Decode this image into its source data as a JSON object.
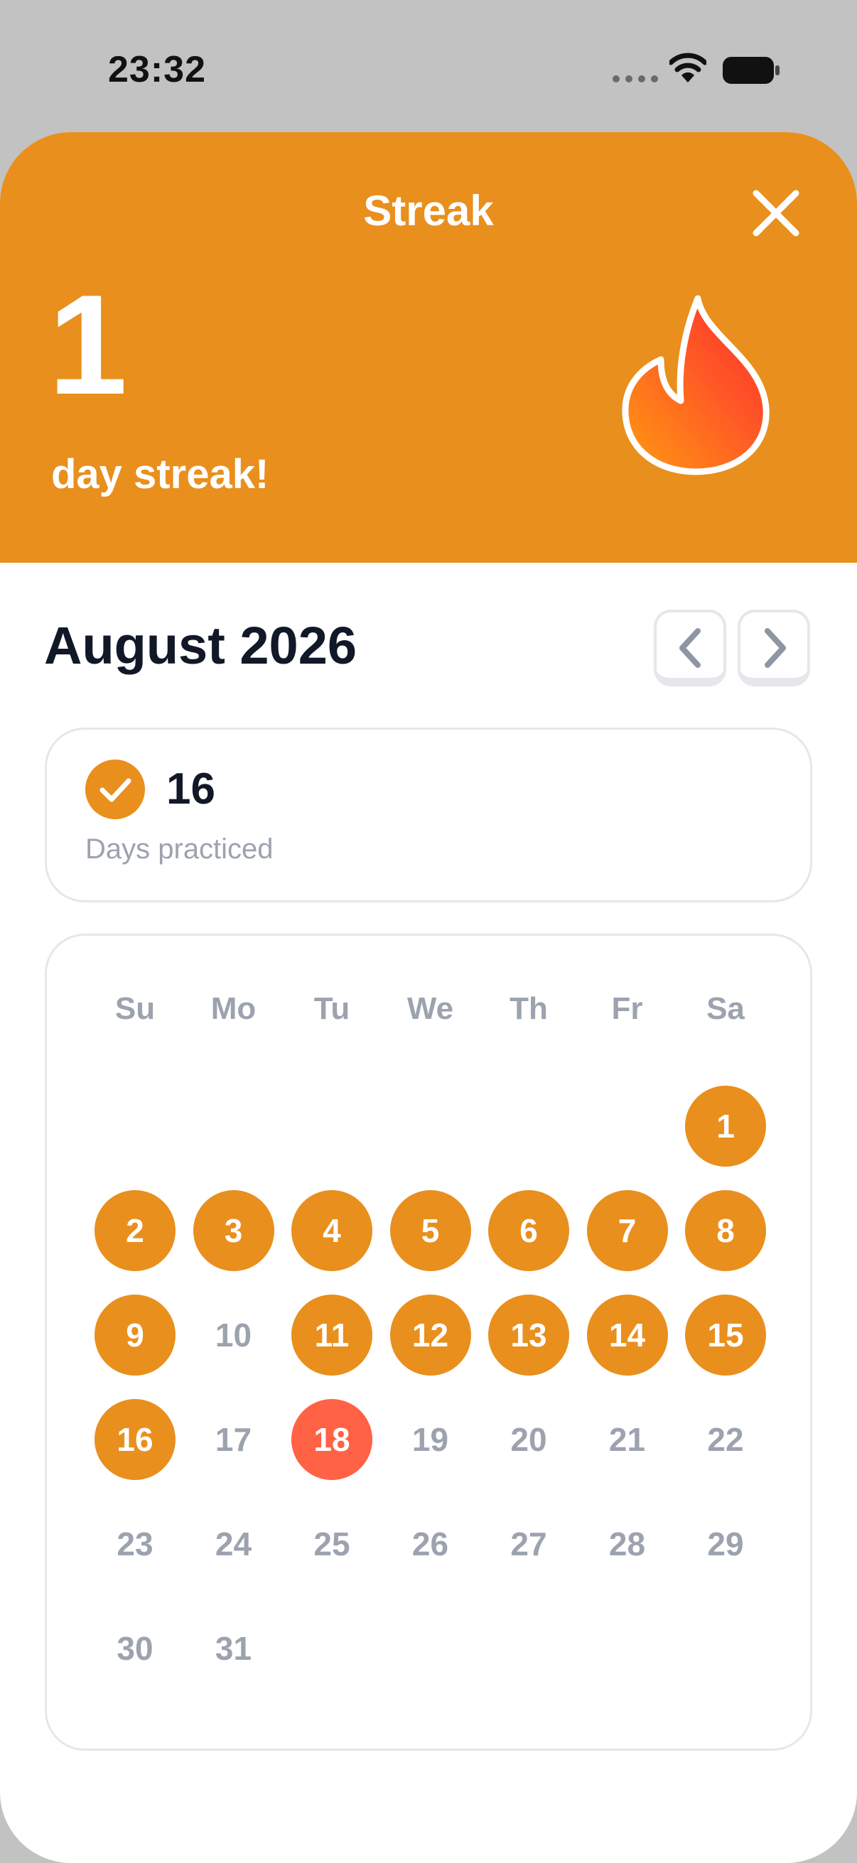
{
  "status_bar": {
    "time": "23:32",
    "icons": [
      "cellular-dots-icon",
      "wifi-icon",
      "battery-icon"
    ]
  },
  "header": {
    "title": "Streak",
    "close_icon": "close-icon",
    "streak_count": "1",
    "streak_label": "day streak!",
    "flame_icon": "flame-icon"
  },
  "calendar_nav": {
    "month_title": "August 2026",
    "prev_icon": "chevron-left-icon",
    "next_icon": "chevron-right-icon"
  },
  "practiced": {
    "icon": "check-circle-icon",
    "count": "16",
    "label": "Days practiced"
  },
  "calendar": {
    "weekdays": [
      "Su",
      "Mo",
      "Tu",
      "We",
      "Th",
      "Fr",
      "Sa"
    ],
    "first_weekday_index": 6,
    "days_in_month": 31,
    "practiced_days": [
      1,
      2,
      3,
      4,
      5,
      6,
      7,
      8,
      9,
      11,
      12,
      13,
      14,
      15,
      16
    ],
    "today": 18
  },
  "colors": {
    "accent": "#e98f1d",
    "today": "#ff6244",
    "muted_text": "#9ca3af",
    "dark_text": "#111827"
  }
}
